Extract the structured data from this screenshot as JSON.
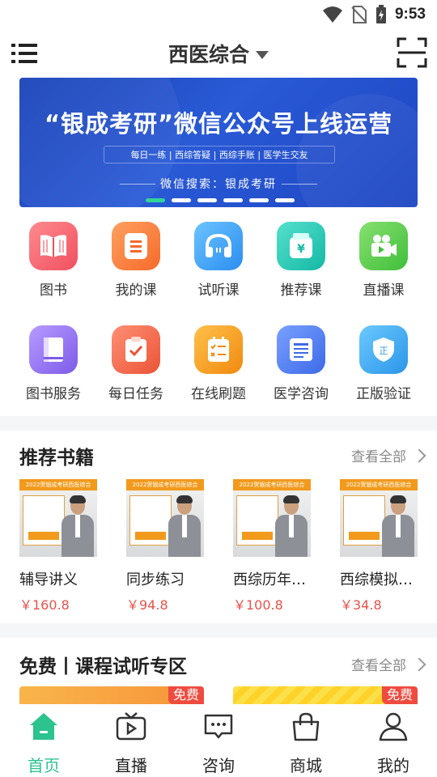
{
  "status_bar": {
    "time": "9:53"
  },
  "header": {
    "title": "西医综合"
  },
  "banner": {
    "title": "“银成考研”微信公众号上线运营",
    "subtitle": "每日一练 | 西综答疑 | 西综手账 | 医学生交友",
    "search_text": "微信搜索：银成考研",
    "page_count": 6,
    "active_index": 0
  },
  "grid": [
    {
      "label": "图书",
      "icon": "open-book-icon",
      "color": "#f4616d"
    },
    {
      "label": "我的课",
      "icon": "list-doc-icon",
      "color": "#fb7a34"
    },
    {
      "label": "试听课",
      "icon": "headphones-icon",
      "color": "#3aa5f4"
    },
    {
      "label": "推荐课",
      "icon": "wallet-yen-icon",
      "color": "#22c9b4"
    },
    {
      "label": "直播课",
      "icon": "video-camera-icon",
      "color": "#5fcd48"
    },
    {
      "label": "图书服务",
      "icon": "book-service-icon",
      "color": "#9d7af0"
    },
    {
      "label": "每日任务",
      "icon": "checklist-icon",
      "color": "#f26b50"
    },
    {
      "label": "在线刷题",
      "icon": "quiz-icon",
      "color": "#f59a16"
    },
    {
      "label": "医学咨询",
      "icon": "article-icon",
      "color": "#4d7cf2"
    },
    {
      "label": "正版验证",
      "icon": "shield-icon",
      "color": "#3aa9ef"
    }
  ],
  "books_section": {
    "title": "推荐书籍",
    "view_all": "查看全部",
    "cover_header": "2022贺银成考研西医综合",
    "items": [
      {
        "name": "辅导讲义",
        "price": "￥160.8"
      },
      {
        "name": "同步练习",
        "price": "￥94.8"
      },
      {
        "name": "西综历年…",
        "price": "￥100.8"
      },
      {
        "name": "西综模拟…",
        "price": "￥34.8"
      }
    ]
  },
  "trial_section": {
    "title": "免费丨课程试听专区",
    "view_all": "查看全部",
    "tag": "免费"
  },
  "bottom_nav": [
    {
      "label": "首页",
      "icon": "home-icon",
      "active": true
    },
    {
      "label": "直播",
      "icon": "tv-play-icon",
      "active": false
    },
    {
      "label": "咨询",
      "icon": "chat-bubble-icon",
      "active": false
    },
    {
      "label": "商城",
      "icon": "shopping-bag-icon",
      "active": false
    },
    {
      "label": "我的",
      "icon": "person-icon",
      "active": false
    }
  ]
}
